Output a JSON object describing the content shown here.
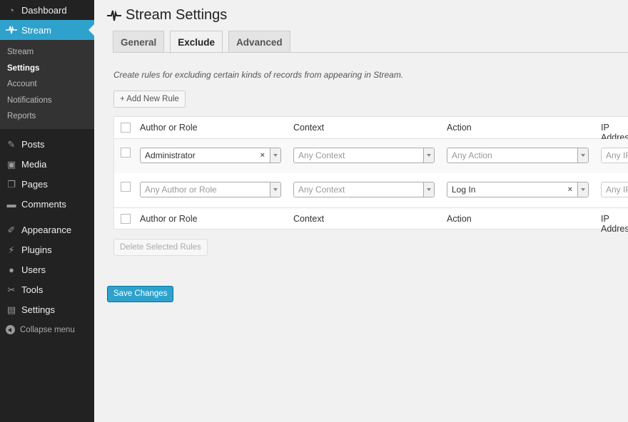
{
  "sidebar": {
    "dashboard": "Dashboard",
    "stream": "Stream",
    "submenu": [
      "Stream",
      "Settings",
      "Account",
      "Notifications",
      "Reports"
    ],
    "posts": "Posts",
    "media": "Media",
    "pages": "Pages",
    "comments": "Comments",
    "appearance": "Appearance",
    "plugins": "Plugins",
    "users": "Users",
    "tools": "Tools",
    "settings": "Settings",
    "collapse": "Collapse menu"
  },
  "page": {
    "title": "Stream Settings",
    "tabs": [
      "General",
      "Exclude",
      "Advanced"
    ],
    "active_tab": "Exclude",
    "description": "Create rules for excluding certain kinds of records from appearing in Stream.",
    "add_rule": "+ Add New Rule",
    "columns": [
      "Author or Role",
      "Context",
      "Action",
      "IP Address"
    ],
    "rules": [
      {
        "author": "Administrator",
        "context": "Any Context",
        "action": "Any Action",
        "ip": "Any IP"
      },
      {
        "author": "Any Author or Role",
        "context": "Any Context",
        "action": "Log In",
        "ip": "Any IP"
      }
    ],
    "delete_selected": "Delete Selected Rules",
    "save": "Save Changes"
  },
  "colors": {
    "accent": "#2ea2cc",
    "sidebar_bg": "#222222",
    "submenu_bg": "#333333"
  }
}
